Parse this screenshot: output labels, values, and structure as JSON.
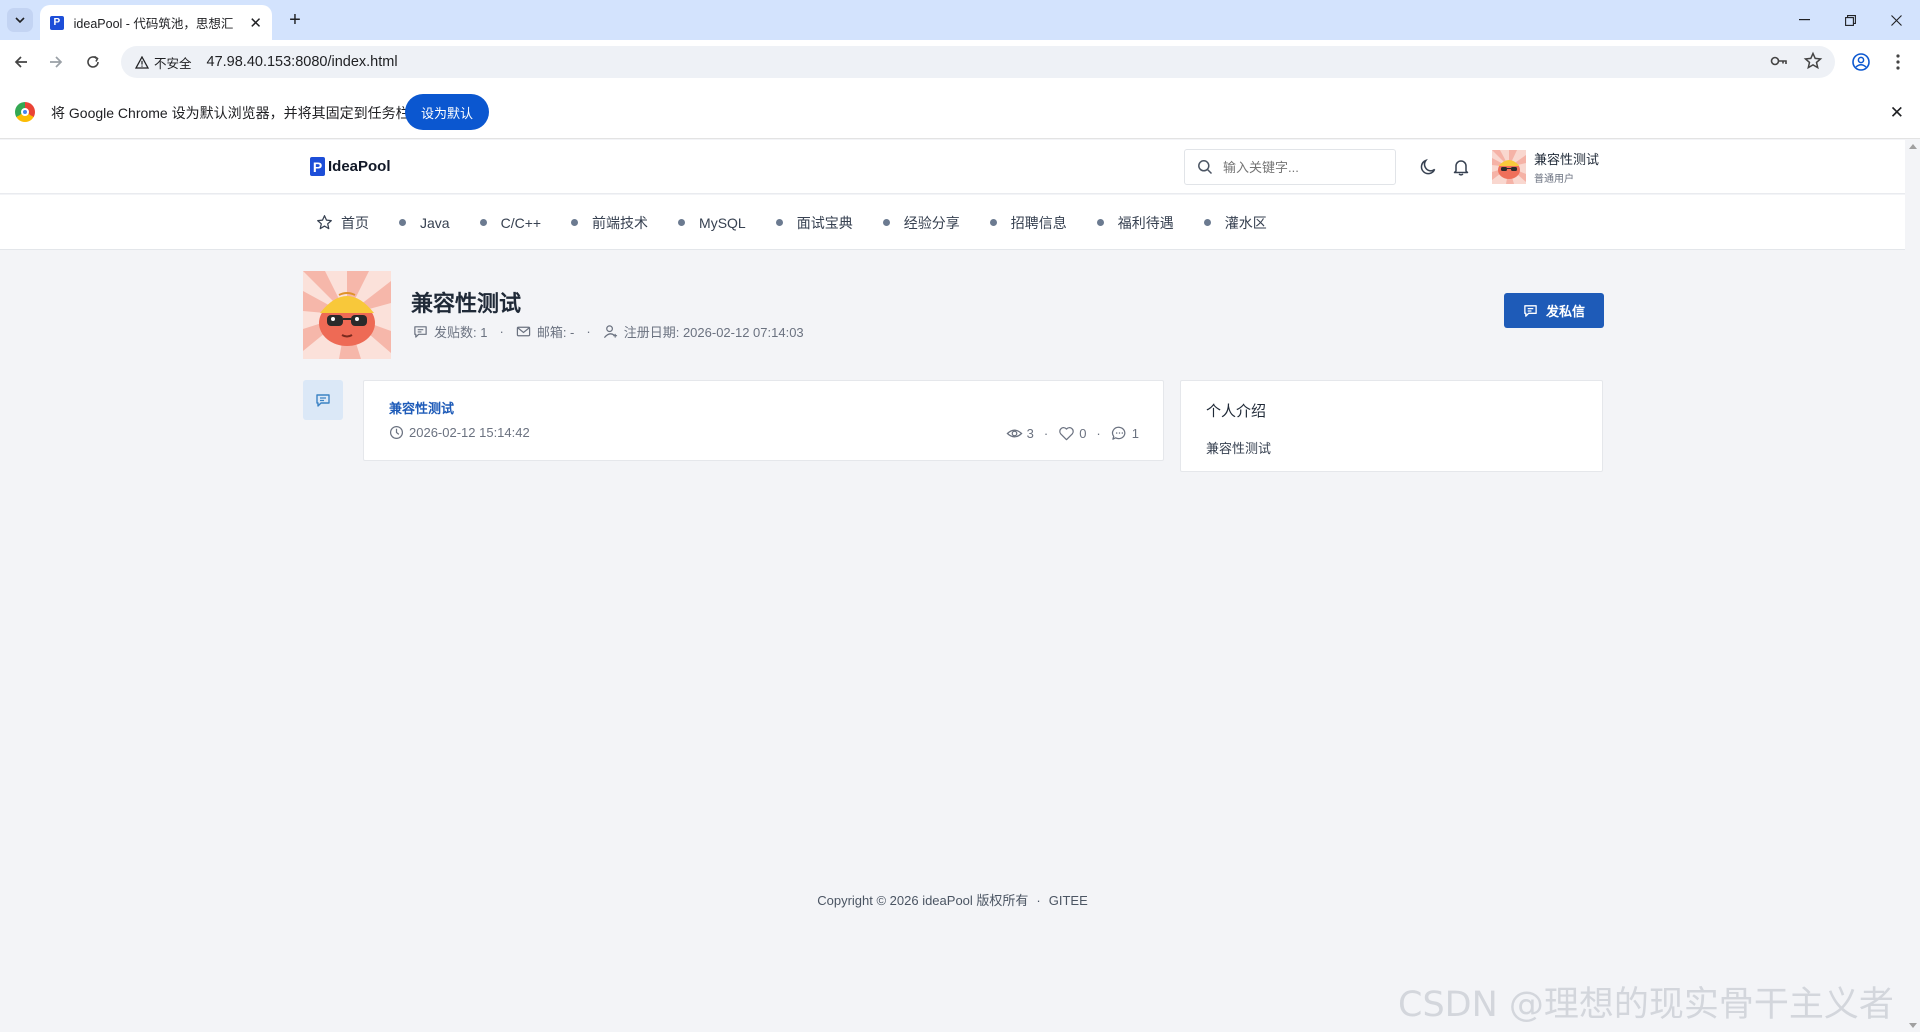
{
  "browser": {
    "tab_title": "ideaPool - 代码筑池，思想汇",
    "tab_favicon": "P",
    "security_label": "不安全",
    "url": "47.98.40.153:8080/index.html",
    "infobar_text": "将 Google Chrome 设为默认浏览器，并将其固定到任务栏",
    "infobar_button": "设为默认"
  },
  "header": {
    "logo_mark": "P",
    "logo_text": "IdeaPool",
    "search_placeholder": "输入关键字...",
    "user_name": "兼容性测试",
    "user_role": "普通用户"
  },
  "nav": {
    "items": [
      "首页",
      "Java",
      "C/C++",
      "前端技术",
      "MySQL",
      "面试宝典",
      "经验分享",
      "招聘信息",
      "福利待遇",
      "灌水区"
    ]
  },
  "profile": {
    "name": "兼容性测试",
    "posts_label": "发贴数: 1",
    "email_label": "邮箱: -",
    "register_label": "注册日期: 2026-02-12 07:14:03",
    "message_button": "发私信"
  },
  "posts": [
    {
      "title": "兼容性测试",
      "date": "2026-02-12 15:14:42",
      "views": "3",
      "likes": "0",
      "comments": "1"
    }
  ],
  "intro": {
    "title": "个人介绍",
    "text": "兼容性测试"
  },
  "footer": {
    "copyright": "Copyright © 2026 ideaPool 版权所有",
    "link": "GITEE"
  },
  "watermark": "CSDN @理想的现实骨干主义者",
  "colors": {
    "accent": "#1e5bb8",
    "brand": "#1d4ed8",
    "page_bg": "#f3f4f7"
  }
}
